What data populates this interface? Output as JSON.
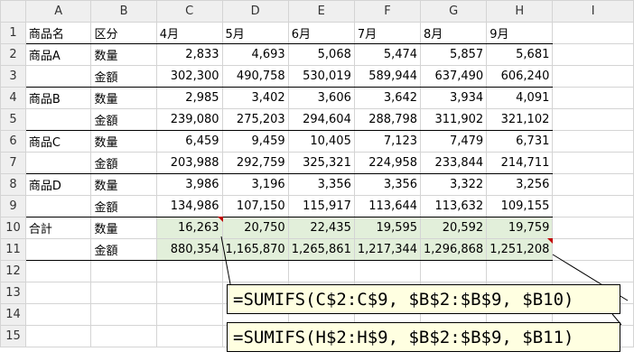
{
  "columns": [
    "A",
    "B",
    "C",
    "D",
    "E",
    "F",
    "G",
    "H",
    "I"
  ],
  "header_row": [
    "商品名",
    "区分",
    "4月",
    "5月",
    "6月",
    "7月",
    "8月",
    "9月"
  ],
  "rows": [
    {
      "num": "2",
      "a": "商品A",
      "b": "数量",
      "v": [
        "2,833",
        "4,693",
        "5,068",
        "5,474",
        "5,857",
        "5,681"
      ]
    },
    {
      "num": "3",
      "a": "",
      "b": "金額",
      "v": [
        "302,300",
        "490,758",
        "530,019",
        "589,944",
        "637,490",
        "606,240"
      ]
    },
    {
      "num": "4",
      "a": "商品B",
      "b": "数量",
      "v": [
        "2,985",
        "3,402",
        "3,606",
        "3,642",
        "3,934",
        "4,091"
      ]
    },
    {
      "num": "5",
      "a": "",
      "b": "金額",
      "v": [
        "239,080",
        "275,203",
        "294,604",
        "288,798",
        "311,902",
        "321,102"
      ]
    },
    {
      "num": "6",
      "a": "商品C",
      "b": "数量",
      "v": [
        "6,459",
        "9,459",
        "10,405",
        "7,123",
        "7,479",
        "6,731"
      ]
    },
    {
      "num": "7",
      "a": "",
      "b": "金額",
      "v": [
        "203,988",
        "292,759",
        "325,321",
        "224,958",
        "233,844",
        "214,711"
      ]
    },
    {
      "num": "8",
      "a": "商品D",
      "b": "数量",
      "v": [
        "3,986",
        "3,196",
        "3,356",
        "3,356",
        "3,322",
        "3,256"
      ]
    },
    {
      "num": "9",
      "a": "",
      "b": "金額",
      "v": [
        "134,986",
        "107,150",
        "115,917",
        "113,644",
        "113,632",
        "109,155"
      ]
    },
    {
      "num": "10",
      "a": "合計",
      "b": "数量",
      "v": [
        "16,263",
        "20,750",
        "22,435",
        "19,595",
        "20,592",
        "19,759"
      ]
    },
    {
      "num": "11",
      "a": "",
      "b": "金額",
      "v": [
        "880,354",
        "1,165,870",
        "1,265,861",
        "1,217,344",
        "1,296,868",
        "1,251,208"
      ]
    }
  ],
  "row_numbers": [
    "1",
    "12",
    "13",
    "14",
    "15"
  ],
  "formulas": {
    "first": "=SUMIFS(C$2:C$9, $B$2:$B$9, $B10)",
    "second": "=SUMIFS(H$2:H$9, $B$2:$B$9, $B11)"
  },
  "colors": {
    "total_fill": "#e2efda",
    "callout_fill": "#ffffe1",
    "comment_marker": "#c00000"
  }
}
